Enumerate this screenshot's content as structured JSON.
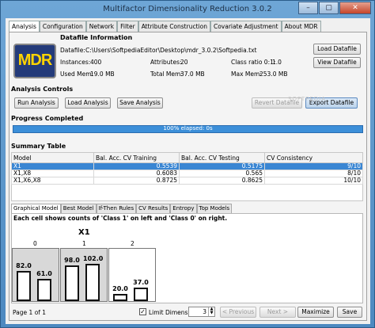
{
  "window": {
    "title": "Multifactor Dimensionality Reduction 3.0.2",
    "minimize": "–",
    "maximize": "▢",
    "close": "✕"
  },
  "tabs": [
    "Analysis",
    "Configuration",
    "Network",
    "Filter",
    "Attribute Construction",
    "Covariate Adjustment",
    "About MDR"
  ],
  "logo": "MDR",
  "datafile": {
    "section": "Datafile Information",
    "datafile_label": "Datafile:",
    "datafile_value": "C:\\Users\\SoftpediaEditor\\Desktop\\mdr_3.0.2\\Softpedia.txt",
    "instances_label": "Instances:",
    "instances_value": "400",
    "attributes_label": "Attributes:",
    "attributes_value": "20",
    "class_ratio_label": "Class ratio 0:1:",
    "class_ratio_value": "1.0",
    "used_mem_label": "Used Mem:",
    "used_mem_value": "19.0 MB",
    "total_mem_label": "Total Mem:",
    "total_mem_value": "37.0 MB",
    "max_mem_label": "Max Mem:",
    "max_mem_value": "253.0 MB",
    "load_button": "Load Datafile",
    "view_button": "View Datafile"
  },
  "analysis_controls": {
    "section": "Analysis Controls",
    "run": "Run Analysis",
    "load": "Load Analysis",
    "save": "Save Analysis",
    "revert": "Revert Datafile",
    "export": "Export Datafile"
  },
  "progress": {
    "section": "Progress Completed",
    "fraction": 1.0,
    "text": "100% elapsed: 0s"
  },
  "summary": {
    "section": "Summary Table",
    "columns": [
      "Model",
      "Bal. Acc. CV Training",
      "Bal. Acc. CV Testing",
      "CV Consistency"
    ],
    "rows": [
      [
        "X1",
        "0.5539",
        "0.5175",
        "9/10"
      ],
      [
        "X1,X8",
        "0.6083",
        "0.565",
        "8/10"
      ],
      [
        "X1,X6,X8",
        "0.8725",
        "0.8625",
        "10/10"
      ]
    ]
  },
  "result_tabs": [
    "Graphical Model",
    "Best Model",
    "If-Then Rules",
    "CV Results",
    "Entropy",
    "Top Models"
  ],
  "graph": {
    "caption": "Each cell shows counts of 'Class 1' on left and 'Class 0' on right.",
    "attribute": "X1",
    "cells": [
      {
        "level": "0",
        "class1": 82.0,
        "class0": 61.0,
        "class1_label": "82.0",
        "class0_label": "61.0"
      },
      {
        "level": "1",
        "class1": 98.0,
        "class0": 102.0,
        "class1_label": "98.0",
        "class0_label": "102.0"
      },
      {
        "level": "2",
        "class1": 20.0,
        "class0": 37.0,
        "class1_label": "20.0",
        "class0_label": "37.0"
      }
    ]
  },
  "footer": {
    "page": "Page 1 of 1",
    "limit_dimension": "Limit Dimension",
    "limit_value": "3",
    "previous": "< Previous",
    "next": "Next >",
    "maximize": "Maximize",
    "save": "Save"
  },
  "watermark": "SOFTPEDIA"
}
